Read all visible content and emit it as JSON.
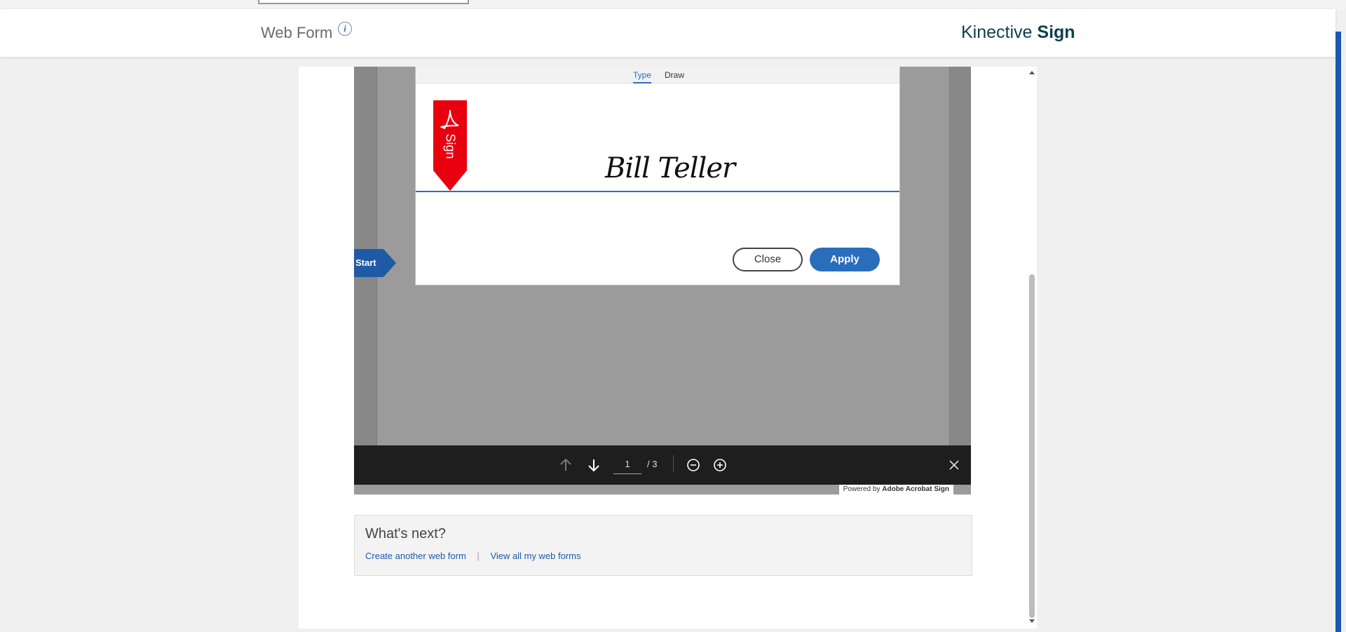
{
  "header": {
    "title": "Web Form",
    "info_glyph": "i",
    "brand_regular": "Kinective",
    "brand_bold": "Sign"
  },
  "signature_dialog": {
    "tabs": [
      "Type",
      "Draw"
    ],
    "active_tab": "Type",
    "sign_tag_label": "Sign",
    "typed_name": "Bill Teller",
    "close_label": "Close",
    "apply_label": "Apply"
  },
  "document": {
    "start_label": "Start"
  },
  "toolbar": {
    "current_page": "1",
    "page_total": "/ 3"
  },
  "powered": {
    "prefix": "Powered by",
    "brand": "Adobe Acrobat Sign"
  },
  "whats_next": {
    "title": "What's next?",
    "link_create": "Create another web form",
    "separator": "|",
    "link_view": "View all my web forms"
  },
  "colors": {
    "accent": "#2a6ebb",
    "sign_tag": "#e8000e",
    "start_flag": "#1f5aa6",
    "brand_text": "#0f3f4f",
    "toolbar_bg": "#1e1e1e"
  }
}
